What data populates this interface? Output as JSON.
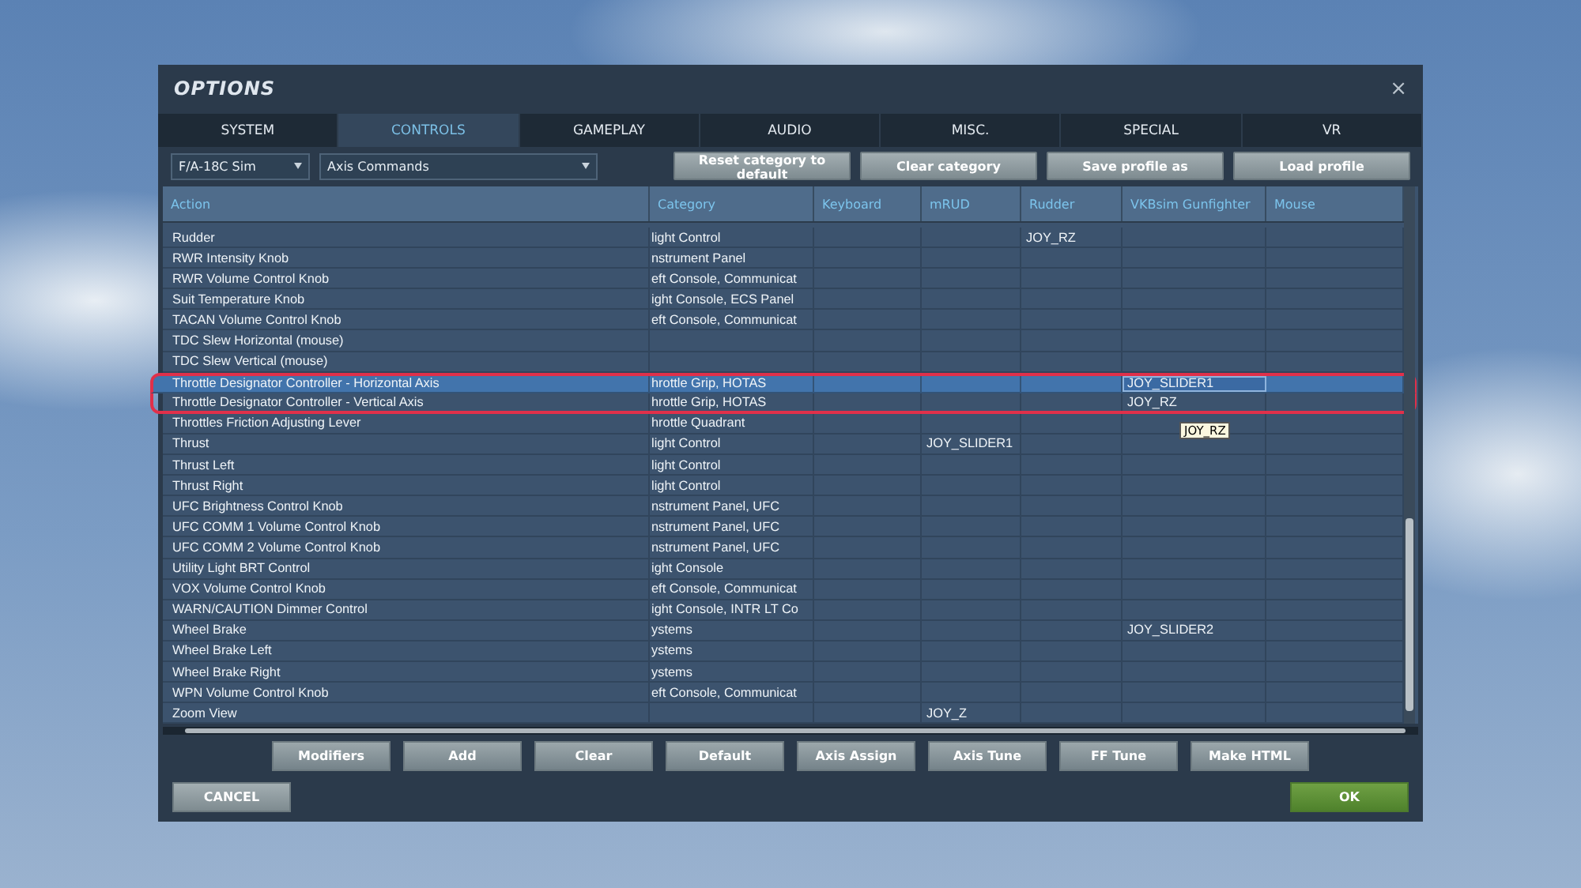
{
  "window": {
    "title": "OPTIONS",
    "close": "×"
  },
  "tabs": [
    {
      "label": "SYSTEM",
      "selected": false
    },
    {
      "label": "CONTROLS",
      "selected": true
    },
    {
      "label": "GAMEPLAY",
      "selected": false
    },
    {
      "label": "AUDIO",
      "selected": false
    },
    {
      "label": "MISC.",
      "selected": false
    },
    {
      "label": "SPECIAL",
      "selected": false
    },
    {
      "label": "VR",
      "selected": false
    }
  ],
  "toolbar": {
    "aircraft": "F/A-18C Sim",
    "category_filter": "Axis Commands",
    "buttons": [
      "Reset category to default",
      "Clear category",
      "Save profile as",
      "Load profile"
    ]
  },
  "table": {
    "columns": [
      "Action",
      "Category",
      "Keyboard",
      "mRUD",
      "Rudder",
      "VKBsim Gunfighter",
      "Mouse"
    ],
    "rows": [
      {
        "cells": [
          "Rudder",
          "light Control",
          null,
          null,
          "JOY_RZ",
          null,
          null
        ],
        "selected": false,
        "outlined": false
      },
      {
        "cells": [
          "RWR Intensity Knob",
          "nstrument Panel",
          null,
          null,
          null,
          null,
          null
        ],
        "selected": false,
        "outlined": false
      },
      {
        "cells": [
          "RWR Volume Control Knob",
          "eft Console, Communicat",
          null,
          null,
          null,
          null,
          null
        ],
        "selected": false,
        "outlined": false
      },
      {
        "cells": [
          "Suit Temperature Knob",
          "ight Console, ECS Panel",
          null,
          null,
          null,
          null,
          null
        ],
        "selected": false,
        "outlined": false
      },
      {
        "cells": [
          "TACAN Volume Control Knob",
          "eft Console, Communicat",
          null,
          null,
          null,
          null,
          null
        ],
        "selected": false,
        "outlined": false
      },
      {
        "cells": [
          "TDC Slew Horizontal (mouse)",
          null,
          null,
          null,
          null,
          null,
          null
        ],
        "selected": false,
        "outlined": false
      },
      {
        "cells": [
          "TDC Slew Vertical (mouse)",
          null,
          null,
          null,
          null,
          null,
          null
        ],
        "selected": false,
        "outlined": false
      },
      {
        "cells": [
          "Throttle Designator Controller - Horizontal Axis",
          "hrottle Grip, HOTAS",
          null,
          null,
          null,
          {
            "text": "JOY_SLIDER1",
            "focused": true
          },
          null
        ],
        "selected": true,
        "outlined": true
      },
      {
        "cells": [
          "Throttle Designator Controller - Vertical Axis",
          "hrottle Grip, HOTAS",
          null,
          null,
          null,
          "JOY_RZ",
          null
        ],
        "selected": false,
        "outlined": true
      },
      {
        "cells": [
          "Throttles Friction Adjusting Lever",
          "hrottle Quadrant",
          null,
          null,
          null,
          null,
          null
        ],
        "selected": false,
        "outlined": false
      },
      {
        "cells": [
          "Thrust",
          "light Control",
          null,
          "JOY_SLIDER1",
          null,
          null,
          null
        ],
        "selected": false,
        "outlined": false
      },
      {
        "cells": [
          "Thrust Left",
          "light Control",
          null,
          null,
          null,
          null,
          null
        ],
        "selected": false,
        "outlined": false
      },
      {
        "cells": [
          "Thrust Right",
          "light Control",
          null,
          null,
          null,
          null,
          null
        ],
        "selected": false,
        "outlined": false
      },
      {
        "cells": [
          "UFC Brightness Control Knob",
          "nstrument Panel, UFC",
          null,
          null,
          null,
          null,
          null
        ],
        "selected": false,
        "outlined": false
      },
      {
        "cells": [
          "UFC COMM 1 Volume Control Knob",
          "nstrument Panel, UFC",
          null,
          null,
          null,
          null,
          null
        ],
        "selected": false,
        "outlined": false
      },
      {
        "cells": [
          "UFC COMM 2 Volume Control Knob",
          "nstrument Panel, UFC",
          null,
          null,
          null,
          null,
          null
        ],
        "selected": false,
        "outlined": false
      },
      {
        "cells": [
          "Utility Light BRT Control",
          "ight Console",
          null,
          null,
          null,
          null,
          null
        ],
        "selected": false,
        "outlined": false
      },
      {
        "cells": [
          "VOX Volume Control Knob",
          "eft Console, Communicat",
          null,
          null,
          null,
          null,
          null
        ],
        "selected": false,
        "outlined": false
      },
      {
        "cells": [
          "WARN/CAUTION Dimmer Control",
          "ight Console, INTR LT Co",
          null,
          null,
          null,
          null,
          null
        ],
        "selected": false,
        "outlined": false
      },
      {
        "cells": [
          "Wheel Brake",
          "ystems",
          null,
          null,
          null,
          "JOY_SLIDER2",
          null
        ],
        "selected": false,
        "outlined": false
      },
      {
        "cells": [
          "Wheel Brake Left",
          "ystems",
          null,
          null,
          null,
          null,
          null
        ],
        "selected": false,
        "outlined": false
      },
      {
        "cells": [
          "Wheel Brake Right",
          "ystems",
          null,
          null,
          null,
          null,
          null
        ],
        "selected": false,
        "outlined": false
      },
      {
        "cells": [
          "WPN Volume Control Knob",
          "eft Console, Communicat",
          null,
          null,
          null,
          null,
          null
        ],
        "selected": false,
        "outlined": false
      },
      {
        "cells": [
          "Zoom View",
          null,
          null,
          "JOY_Z",
          null,
          null,
          null
        ],
        "selected": false,
        "outlined": false
      }
    ],
    "tooltip": "JOY_RZ"
  },
  "action_buttons": [
    "Modifiers",
    "Add",
    "Clear",
    "Default",
    "Axis Assign",
    "Axis Tune",
    "FF Tune",
    "Make HTML"
  ],
  "footer": {
    "cancel": "CANCEL",
    "ok": "OK"
  }
}
